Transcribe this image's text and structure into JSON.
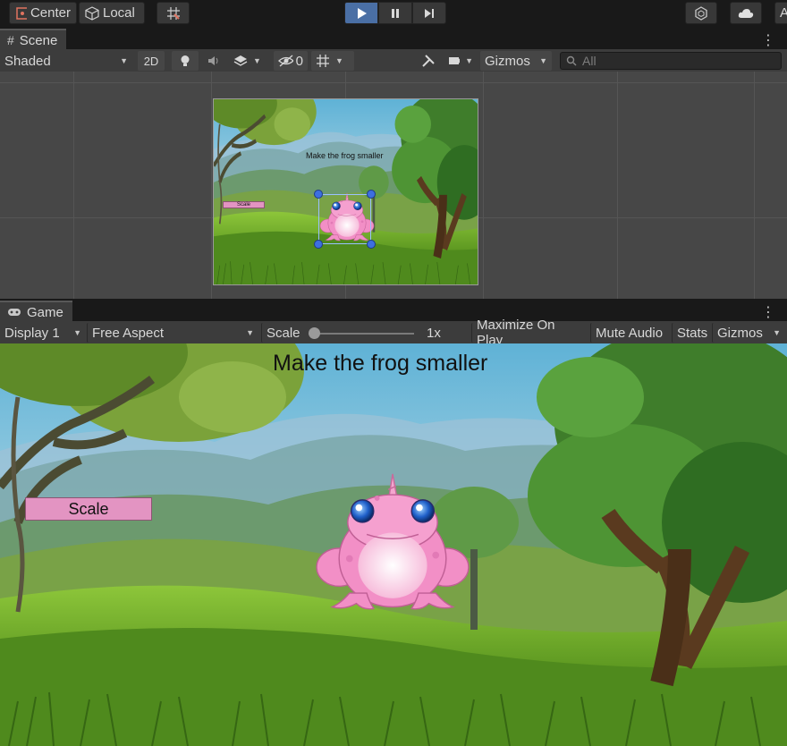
{
  "toolbar": {
    "pivot_center_label": "Center",
    "pivot_local_label": "Local",
    "account_partial_label": "A"
  },
  "scene_panel": {
    "tab_label": "Scene",
    "draw_mode": "Shaded",
    "mode_2d_label": "2D",
    "hidden_count": "0",
    "gizmos_label": "Gizmos",
    "search_placeholder": "All",
    "preview_title": "Make the frog smaller",
    "preview_button_label": "Scale"
  },
  "game_panel": {
    "tab_label": "Game",
    "display_label": "Display 1",
    "aspect_label": "Free Aspect",
    "scale_label": "Scale",
    "scale_value": "1x",
    "scale_fraction": 0.0,
    "maximize_label": "Maximize On Play",
    "mute_label": "Mute Audio",
    "stats_label": "Stats",
    "gizmos_label": "Gizmos",
    "game_title": "Make the frog smaller",
    "game_button_label": "Scale"
  },
  "colors": {
    "play_active": "#4a6fa5",
    "button_pink": "#e394c2",
    "frog_pink": "#f28fc6"
  }
}
